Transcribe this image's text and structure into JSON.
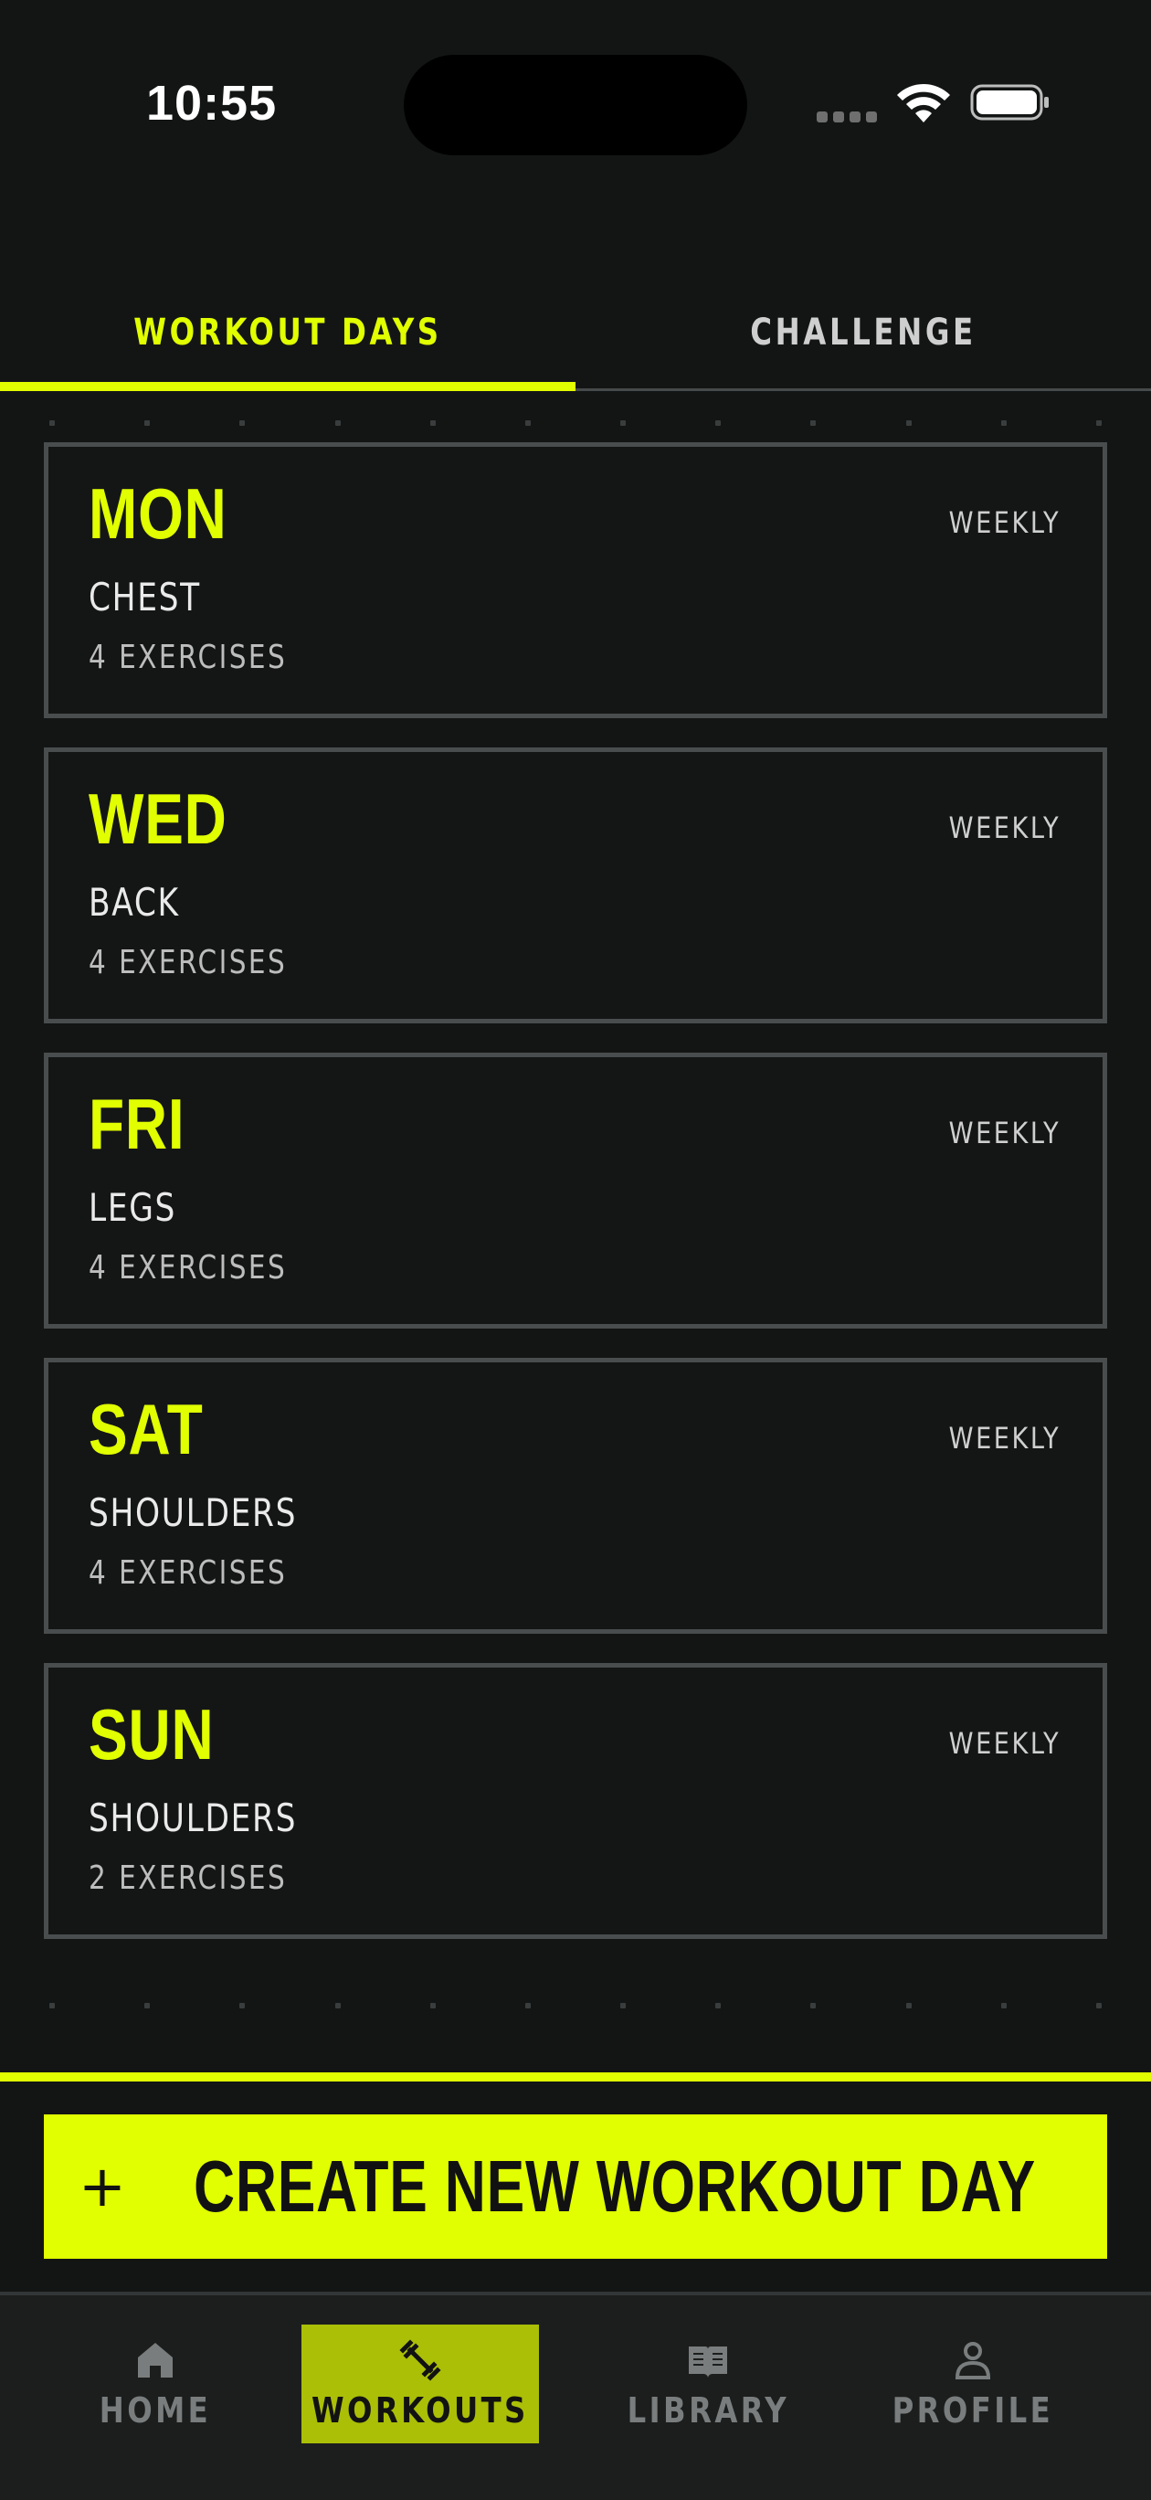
{
  "status_bar": {
    "time": "10:55",
    "icons": [
      "signal-dots-icon",
      "wifi-icon",
      "battery-icon"
    ]
  },
  "tabs": [
    {
      "label": "WORKOUT DAYS",
      "active": true
    },
    {
      "label": "CHALLENGE",
      "active": false
    }
  ],
  "workout_days": [
    {
      "day": "MON",
      "frequency": "WEEKLY",
      "focus": "CHEST",
      "exercises": "4 EXERCISES"
    },
    {
      "day": "WED",
      "frequency": "WEEKLY",
      "focus": "BACK",
      "exercises": "4 EXERCISES"
    },
    {
      "day": "FRI",
      "frequency": "WEEKLY",
      "focus": "LEGS",
      "exercises": "4 EXERCISES"
    },
    {
      "day": "SAT",
      "frequency": "WEEKLY",
      "focus": "SHOULDERS",
      "exercises": "4 EXERCISES"
    },
    {
      "day": "SUN",
      "frequency": "WEEKLY",
      "focus": "SHOULDERS",
      "exercises": "2 EXERCISES"
    }
  ],
  "create_button": {
    "icon": "plus-icon",
    "label": "CREATE NEW WORKOUT DAY"
  },
  "nav": [
    {
      "label": "HOME",
      "icon": "home-icon",
      "active": false
    },
    {
      "label": "WORKOUTS",
      "icon": "dumbbell-icon",
      "active": true
    },
    {
      "label": "LIBRARY",
      "icon": "book-icon",
      "active": false
    },
    {
      "label": "PROFILE",
      "icon": "person-icon",
      "active": false
    }
  ],
  "colors": {
    "accent": "#e1ff00",
    "background": "#131515",
    "card_border": "#4a4d4d",
    "nav_active": "#aabf06"
  }
}
